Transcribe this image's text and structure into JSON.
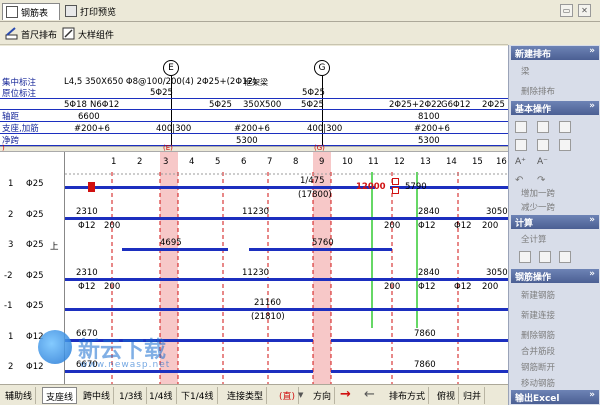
{
  "tabs": [
    {
      "label": "钢筋表"
    },
    {
      "label": "打印预览"
    }
  ],
  "toolbar": {
    "ruler_label": "首尺排布",
    "detail_label": "大样组件"
  },
  "header": {
    "row_labels": [
      "集中标注",
      "原位标注",
      "",
      "轴距",
      "支座,加筋",
      "净跨"
    ],
    "concentrated_text": "L4,5 350X650 Φ8@100/200(4) 2Φ25+(2Φ12)",
    "frame_tag": "框架梁",
    "axis_labels": [
      "E",
      "G"
    ],
    "row1_cells": [
      "5Φ25",
      "5Φ25"
    ],
    "row2_cells": [
      "5Φ18",
      "N6Φ12",
      "5Φ25",
      "350X500",
      "5Φ25",
      "2Φ25+2Φ22",
      "G6Φ12",
      "2Φ25"
    ],
    "spans": [
      "6600",
      "8100"
    ],
    "support_cells": [
      "#200+6",
      "400|300",
      "#200+6",
      "400|300",
      "#200+6"
    ],
    "net_cells": [
      "5300",
      "5300"
    ]
  },
  "ruler": {
    "markers": [
      "(E)",
      "(G)"
    ],
    "ticks": [
      "1",
      "2",
      "3",
      "4",
      "5",
      "6",
      "7",
      "8",
      "9",
      "10",
      "11",
      "12",
      "13",
      "14",
      "15",
      "16"
    ]
  },
  "bars": [
    {
      "row": "1",
      "spec": "Φ25",
      "note": "",
      "texts": [
        "1/475",
        "(17800)",
        "12000",
        "5790"
      ]
    },
    {
      "row": "2",
      "spec": "Φ25",
      "note": "",
      "texts": [
        "2310",
        "Φ12",
        "200",
        "11230",
        "200",
        "Φ12",
        "2840",
        "Φ12",
        "200",
        "3050"
      ]
    },
    {
      "row": "3",
      "spec": "Φ25",
      "note": "上",
      "texts": [
        "4695",
        "5760"
      ]
    },
    {
      "row": "-2",
      "spec": "Φ25",
      "note": "",
      "texts": [
        "2310",
        "Φ12",
        "200",
        "11230",
        "200",
        "Φ12",
        "2840",
        "Φ12",
        "200",
        "3050"
      ]
    },
    {
      "row": "-1",
      "spec": "Φ25",
      "note": "",
      "texts": [
        "21160",
        "(21810)"
      ]
    },
    {
      "row": "1",
      "spec": "Φ12",
      "note": "",
      "texts": [
        "6670",
        "7860"
      ]
    },
    {
      "row": "2",
      "spec": "Φ12",
      "note": "",
      "texts": [
        "6670",
        "7860"
      ]
    }
  ],
  "sidebar": {
    "sections": [
      {
        "title": "新建排布",
        "items": [
          "梁",
          "删除排布"
        ]
      },
      {
        "title": "基本操作",
        "items": []
      },
      {
        "title": "计算",
        "items": [
          "全计算"
        ]
      },
      {
        "title": "钢筋操作",
        "items": [
          "新建钢筋",
          "新建连接",
          "删除钢筋",
          "合并筋段",
          "钢筋断开",
          "移动钢筋"
        ]
      },
      {
        "title": "输出Excel",
        "items": []
      }
    ],
    "misc_items": [
      "增加一跨",
      "减少一跨"
    ]
  },
  "bottom": {
    "buttons": [
      "辅助线",
      "支座线",
      "跨中线",
      "1/3线",
      "1/4线",
      "下1/4线",
      "连接类型",
      "(直)",
      "方向",
      "排布方式",
      "俯视",
      "归并"
    ]
  },
  "watermark": {
    "text": "新云下载",
    "url": "www.newasp.net"
  },
  "colors": {
    "bar": "#1c2fbf",
    "grid": "#1c2fbf",
    "highlight": "#f7c8c8",
    "green": "#33cc33",
    "red": "#d01010"
  }
}
